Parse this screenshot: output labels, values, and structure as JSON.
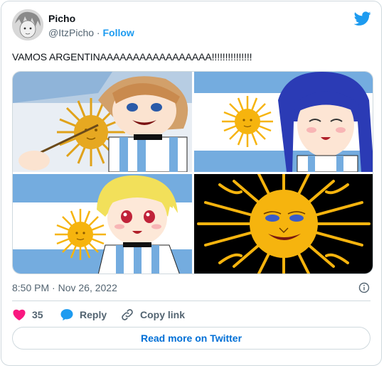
{
  "user": {
    "name": "Picho",
    "handle": "@ItzPicho",
    "separator": "·",
    "follow_label": "Follow"
  },
  "tweet": {
    "text": "VAMOS ARGENTINAAAAAAAAAAAAAAAAA!!!!!!!!!!!!!!!",
    "timestamp": "8:50 PM · Nov 26, 2022"
  },
  "actions": {
    "like_count": "35",
    "reply_label": "Reply",
    "copy_label": "Copy link"
  },
  "read_more_label": "Read more on Twitter",
  "colors": {
    "accent": "#1d9bf0",
    "like": "#f91880",
    "flag_blue": "#74acdf",
    "sun": "#f6b40e"
  },
  "icons": [
    "twitter-logo-icon",
    "info-icon",
    "heart-icon",
    "reply-bubble-icon",
    "link-icon"
  ]
}
